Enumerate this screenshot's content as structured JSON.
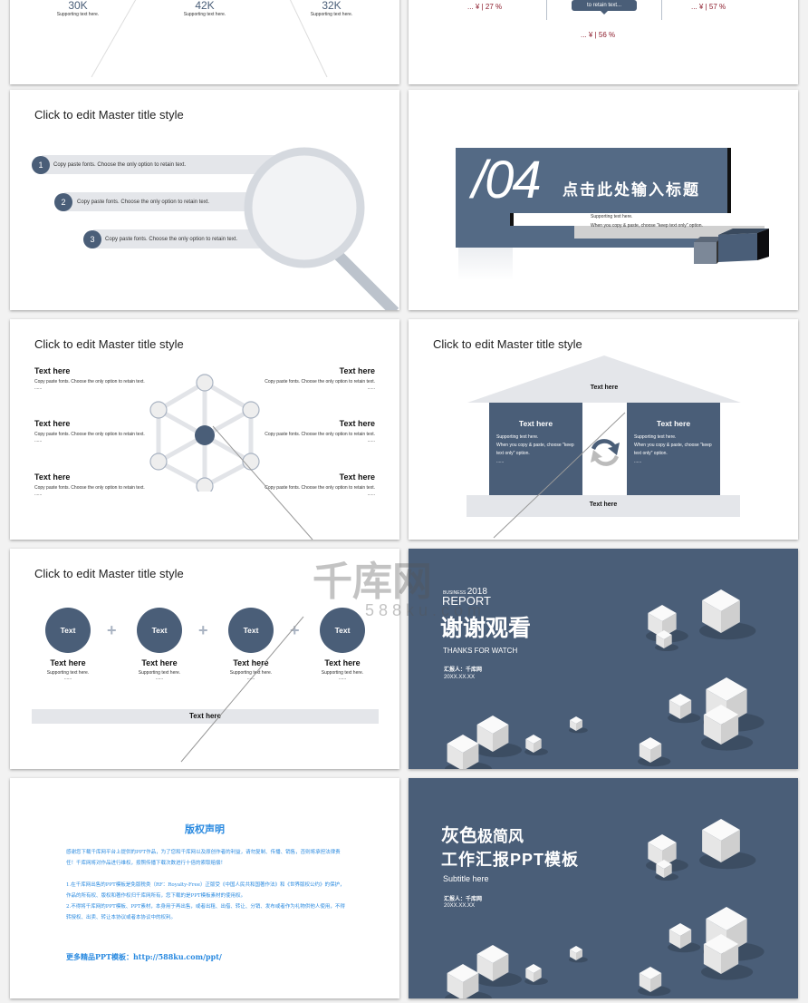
{
  "slide_a": {
    "stats": [
      {
        "value": "30K",
        "text": "Supporting text here."
      },
      {
        "value": "42K",
        "text": "Supporting text here."
      },
      {
        "value": "32K",
        "text": "Supporting text here."
      }
    ]
  },
  "slide_b": {
    "tooltip": "to retain text...",
    "values": [
      "... ¥ | 27 %",
      "... ¥ | 57 %",
      "... ¥ | 56 %"
    ],
    "value_color": "#8b1a2a"
  },
  "slide_magnifier": {
    "title": "Click to edit Master title style",
    "items": [
      {
        "num": "1",
        "text": "Copy paste fonts. Choose the only option to retain text."
      },
      {
        "num": "2",
        "text": "Copy paste fonts. Choose the only option to retain text."
      },
      {
        "num": "3",
        "text": "Copy paste fonts. Choose the only option to retain text."
      }
    ]
  },
  "slide_section": {
    "number": "/04",
    "heading": "点击此处输入标题",
    "line1": "Supporting text here.",
    "line2": "When you copy & paste, choose \"keep text only\" option."
  },
  "slide_hex": {
    "title": "Click to edit Master title style",
    "blocks": [
      {
        "heading": "Text here",
        "text": "Copy paste fonts. Choose the only option to retain text.",
        "more": "......"
      },
      {
        "heading": "Text here",
        "text": "Copy paste fonts. Choose the only option to retain text.",
        "more": "......"
      },
      {
        "heading": "Text here",
        "text": "Copy paste fonts. Choose the only option to retain text.",
        "more": "......"
      },
      {
        "heading": "Text here",
        "text": "Copy paste fonts. Choose the only option to retain text.",
        "more": "......"
      },
      {
        "heading": "Text here",
        "text": "Copy paste fonts. Choose the only option to retain text.",
        "more": "......"
      },
      {
        "heading": "Text here",
        "text": "Copy paste fonts. Choose the only option to retain text.",
        "more": "......"
      }
    ]
  },
  "slide_house": {
    "title": "Click to edit Master title style",
    "roof": "Text here",
    "base": "Text here",
    "panels": [
      {
        "heading": "Text here",
        "b1": "Supporting text here.",
        "b2": "When you copy & paste, choose \"keep text only\" option.",
        "b3": "......"
      },
      {
        "heading": "Text here",
        "b1": "Supporting text here.",
        "b2": "When you copy & paste, choose \"keep text only\" option.",
        "b3": "......"
      }
    ]
  },
  "slide_circles": {
    "title": "Click to edit Master title style",
    "bar": "Text here",
    "items": [
      {
        "circle": "Text",
        "heading": "Text here",
        "text": "Supporting text here.",
        "more": "......"
      },
      {
        "circle": "Text",
        "heading": "Text here",
        "text": "Supporting text here.",
        "more": "......"
      },
      {
        "circle": "Text",
        "heading": "Text here",
        "text": "Supporting text here.",
        "more": "......"
      },
      {
        "circle": "Text",
        "heading": "Text here",
        "text": "Supporting text here.",
        "more": "......"
      }
    ]
  },
  "slide_thanks": {
    "business": "BUSINESS",
    "year": "2018",
    "report": "REPORT",
    "title": "谢谢观看",
    "subtitle": "THANKS FOR WATCH",
    "reporter": "汇报人：千库网",
    "date": "20XX.XX.XX"
  },
  "watermark": {
    "logo": "千库网",
    "url": "588ku.com"
  },
  "slide_copyright": {
    "title": "版权声明",
    "p1": "感谢您下载千库网平台上提供的PPT作品，为了您和千库网以及原创作者的利益，请勿复制、传播、销售，否则将承担法律责任！千库网将对作品进行维权，按照传播下载次数进行十倍的索取赔偿！",
    "p2": "1.在千库网出售的PPT模板是免版税类（RF：Royalty-Free）正版受《中国人民共和国著作法》和《世界版权公约》的保护，作品的所有权、版权和著作权归千库网所有，您下载的是PPT模板素材的使用权。",
    "p3": "2.不得将千库网的PPT模板、PPT素材，本身用于再出售，或者出租、出借、转让、分销、发布或者作为礼物供他人使用，不得转授权、出卖、转让本协议或者本协议中的权利。",
    "more": "更多精品PPT模板：http://588ku.com/ppt/"
  },
  "slide_cover": {
    "title1a": "灰色",
    "title1b": "极简风",
    "title2": "工作汇报PPT模板",
    "subtitle": "Subtitle here",
    "reporter": "汇报人：千库网",
    "date": "20XX.XX.XX"
  },
  "colors": {
    "primary": "#4a5e78",
    "light_gray": "#e4e6ea",
    "link_blue": "#2a8ae0"
  }
}
